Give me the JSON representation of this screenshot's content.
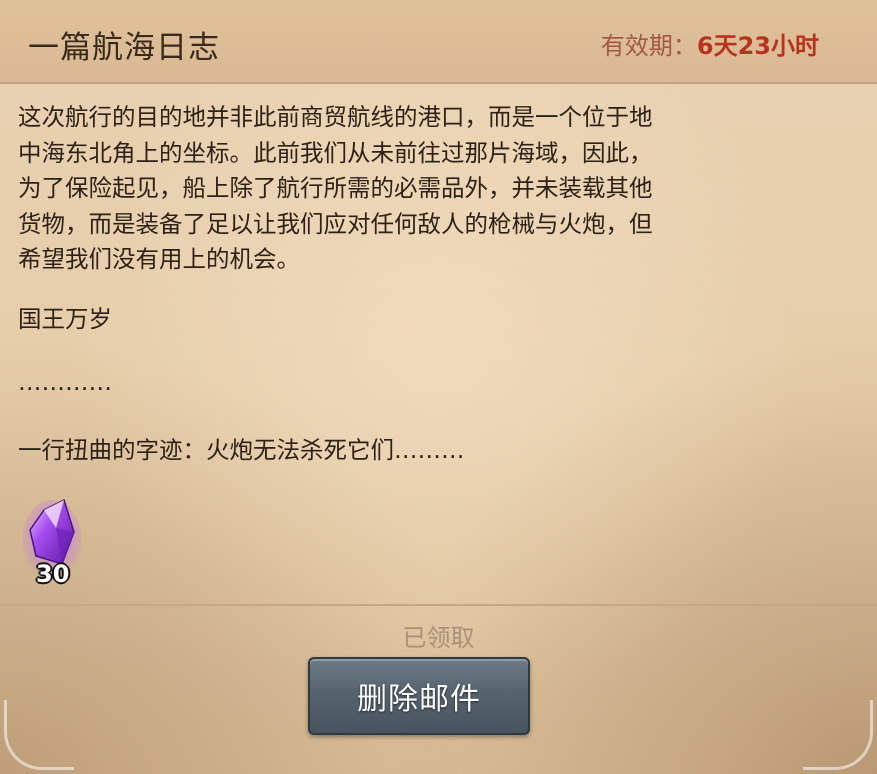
{
  "mail": {
    "title": "一篇航海日志",
    "expiry_label": "有效期：",
    "expiry_value": "6天23小时"
  },
  "body": {
    "paragraph_lines": [
      "这次航行的目的地并非此前商贸航线的港口，而是一个位于地",
      "中海东北角上的坐标。此前我们从未前往过那片海域，因此，",
      "为了保险起见，船上除了航行所需的必需品外，并未装载其他",
      "货物，而是装备了足以让我们应对任何敌人的枪械与火炮，但",
      "希望我们没有用上的机会。"
    ],
    "line_long_live": "国王万岁",
    "line_ellipsis": "…………",
    "line_twisted": "一行扭曲的字迹：火炮无法杀死它们………"
  },
  "reward": {
    "icon": "purple-crystal-icon",
    "count": "30"
  },
  "footer": {
    "claimed_label": "已领取",
    "delete_button_label": "删除邮件"
  },
  "colors": {
    "parchment": "#e6cdaa",
    "expiry_value": "#b8331d",
    "button": "#56646f"
  }
}
